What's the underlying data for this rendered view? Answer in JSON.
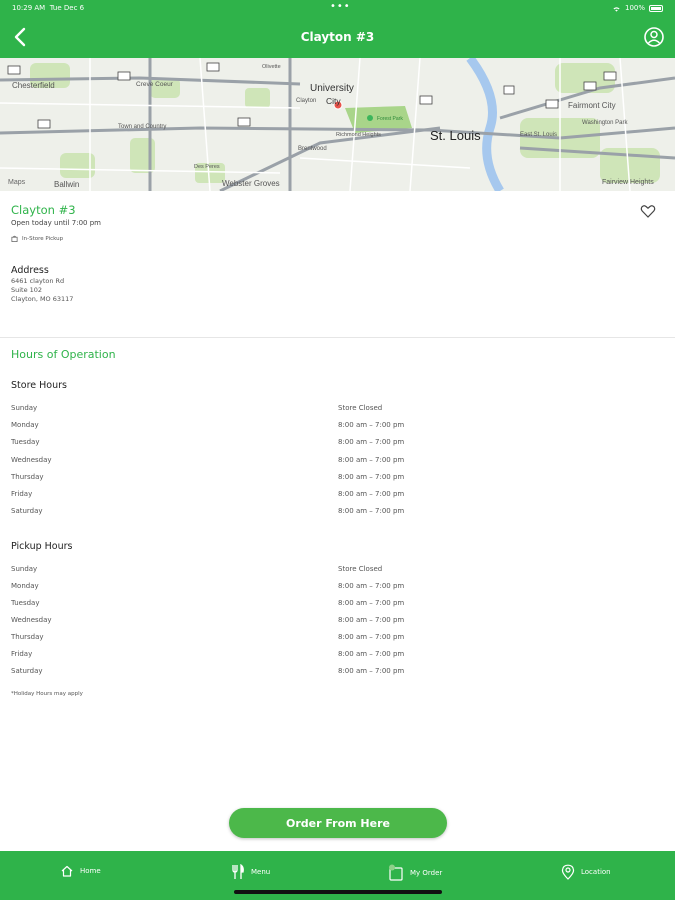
{
  "status_bar": {
    "time": "10:29 AM",
    "date": "Tue Dec 6",
    "battery": "100%"
  },
  "header": {
    "title": "Clayton #3"
  },
  "map": {
    "labels": [
      "Chesterfield",
      "Creve Coeur",
      "Olivette",
      "University City",
      "Clayton",
      "Forest Park",
      "St. Louis",
      "Fairmont City",
      "Washington Park",
      "Town and Country",
      "Brentwood",
      "Richmond Heights",
      "East St. Louis",
      "Des Peres",
      "Ballwin",
      "Webster Groves",
      "Fairview Heights",
      "Maps"
    ]
  },
  "store": {
    "name": "Clayton #3",
    "open_status": "Open today until 7:00 pm",
    "pickup_label": "In-Store Pickup"
  },
  "address": {
    "label": "Address",
    "line1": "6461 clayton Rd",
    "line2": "Suite 102",
    "line3": "Clayton, MO 63117"
  },
  "hours": {
    "title": "Hours of Operation",
    "store_title": "Store Hours",
    "store_hours": [
      {
        "day": "Sunday",
        "time": "Store Closed"
      },
      {
        "day": "Monday",
        "time": "8:00 am – 7:00 pm"
      },
      {
        "day": "Tuesday",
        "time": "8:00 am – 7:00 pm"
      },
      {
        "day": "Wednesday",
        "time": "8:00 am – 7:00 pm"
      },
      {
        "day": "Thursday",
        "time": "8:00 am – 7:00 pm"
      },
      {
        "day": "Friday",
        "time": "8:00 am – 7:00 pm"
      },
      {
        "day": "Saturday",
        "time": "8:00 am – 7:00 pm"
      }
    ],
    "pickup_title": "Pickup Hours",
    "pickup_hours": [
      {
        "day": "Sunday",
        "time": "Store Closed"
      },
      {
        "day": "Monday",
        "time": "8:00 am – 7:00 pm"
      },
      {
        "day": "Tuesday",
        "time": "8:00 am – 7:00 pm"
      },
      {
        "day": "Wednesday",
        "time": "8:00 am – 7:00 pm"
      },
      {
        "day": "Thursday",
        "time": "8:00 am – 7:00 pm"
      },
      {
        "day": "Friday",
        "time": "8:00 am – 7:00 pm"
      },
      {
        "day": "Saturday",
        "time": "8:00 am – 7:00 pm"
      }
    ],
    "note": "*Holiday Hours may apply"
  },
  "order_button": {
    "label": "Order From Here"
  },
  "tabs": [
    {
      "label": "Home",
      "icon": "home-icon"
    },
    {
      "label": "Menu",
      "icon": "fork-knife-icon"
    },
    {
      "label": "My Order",
      "icon": "bag-icon"
    },
    {
      "label": "Location",
      "icon": "map-pin-icon"
    }
  ],
  "colors": {
    "brand_green": "#2fb34a",
    "button_green": "#4cb84a",
    "text_dark": "#222222",
    "text_muted": "#555555"
  }
}
